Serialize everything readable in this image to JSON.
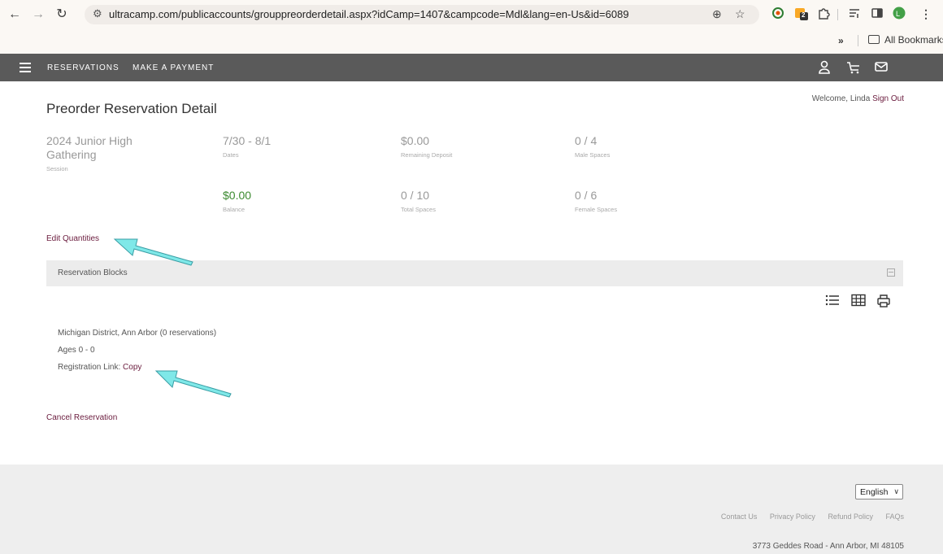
{
  "browser": {
    "url": "ultracamp.com/publicaccounts/grouppreorderdetail.aspx?idCamp=1407&campcode=Mdl&lang=en-Us&id=6089",
    "extension_badge": "2",
    "profile_initial": "L",
    "bookmarks_label": "All Bookmarks"
  },
  "nav": {
    "links": [
      "RESERVATIONS",
      "MAKE A PAYMENT"
    ]
  },
  "page": {
    "title": "Preorder Reservation Detail",
    "welcome_text": "Welcome, Linda",
    "sign_out": "Sign Out"
  },
  "stats": {
    "session": {
      "value": "2024 Junior High Gathering",
      "label": "Session"
    },
    "dates": {
      "value": "7/30 - 8/1",
      "label": "Dates"
    },
    "remaining_deposit": {
      "value": "$0.00",
      "label": "Remaining Deposit"
    },
    "male_spaces": {
      "value": "0 / 4",
      "label": "Male Spaces"
    },
    "balance": {
      "value": "$0.00",
      "label": "Balance"
    },
    "total_spaces": {
      "value": "0 / 10",
      "label": "Total Spaces"
    },
    "female_spaces": {
      "value": "0 / 6",
      "label": "Female Spaces"
    }
  },
  "actions": {
    "edit_quantities": "Edit Quantities",
    "cancel_reservation": "Cancel Reservation"
  },
  "reservation_blocks": {
    "title": "Reservation Blocks",
    "block_name": "Michigan District, Ann Arbor (0 reservations)",
    "ages": "Ages 0 - 0",
    "registration_link_label": "Registration Link:",
    "copy_label": "Copy"
  },
  "footer": {
    "language": "English",
    "links": [
      "Contact Us",
      "Privacy Policy",
      "Refund Policy",
      "FAQs"
    ],
    "address": "3773 Geddes Road - Ann Arbor, MI 48105"
  },
  "colors": {
    "link": "#6a1b3d",
    "nav_bg": "#5a5a5a",
    "balance_green": "#3b8a2f",
    "annotation_arrow": "#7fe8e8"
  }
}
